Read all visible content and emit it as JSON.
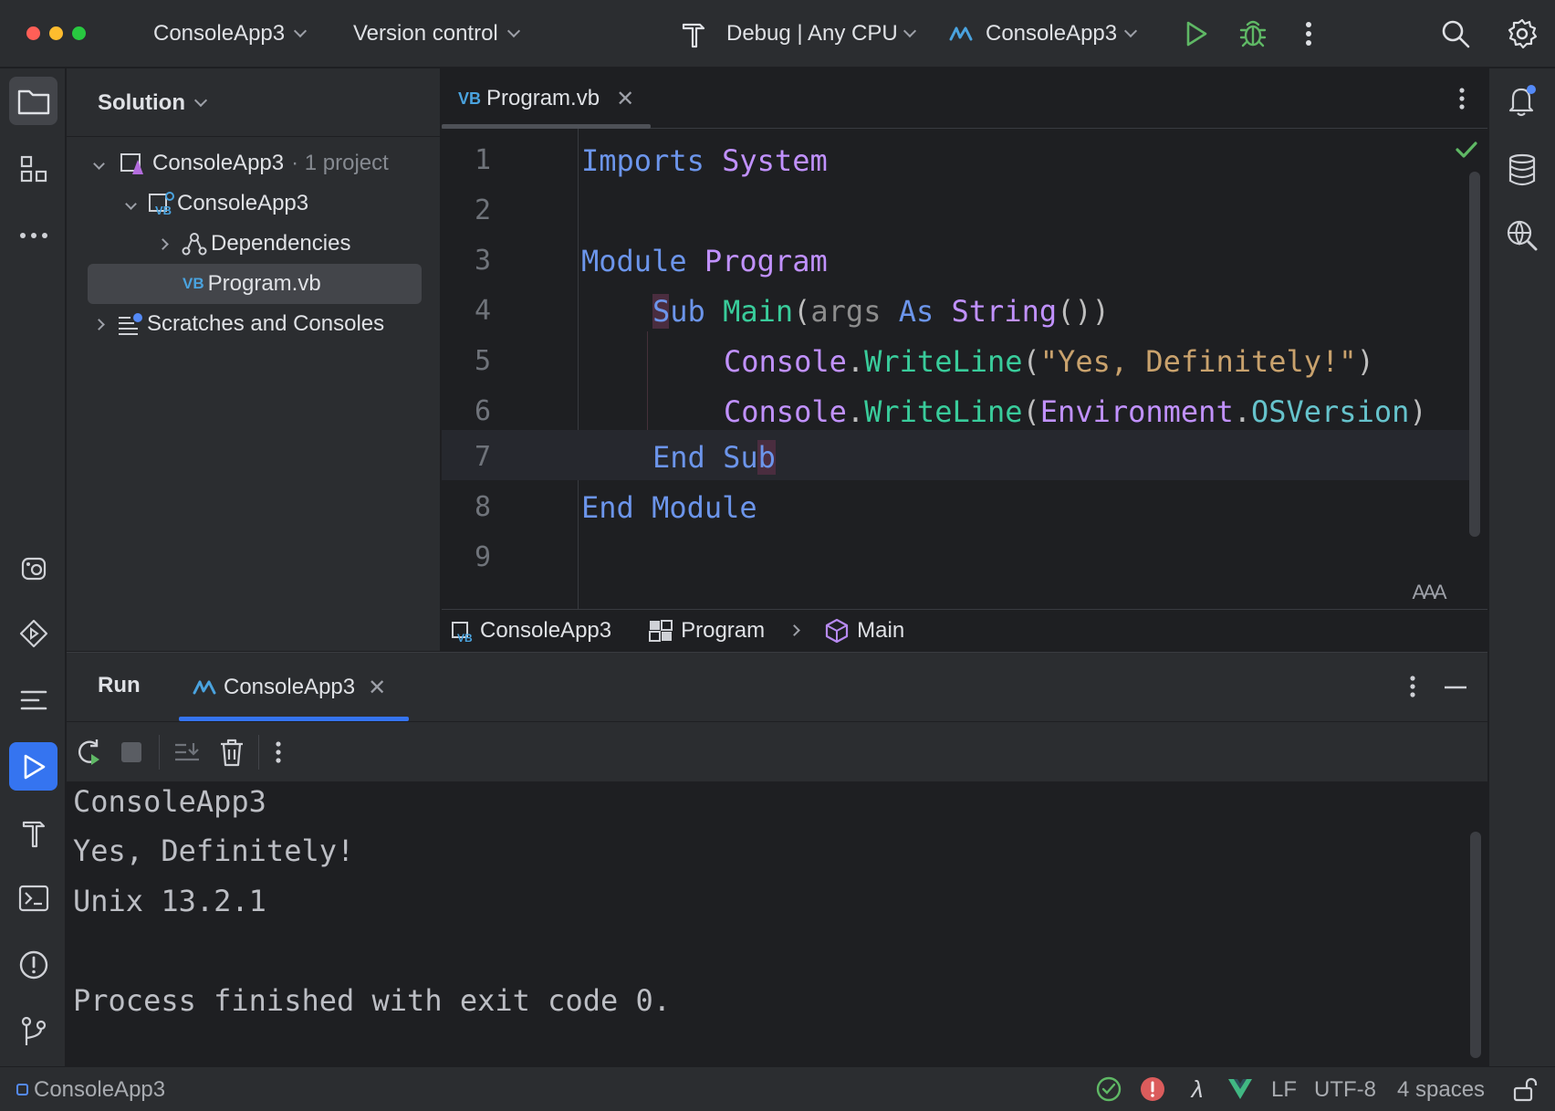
{
  "titlebar": {
    "project_name": "ConsoleApp3",
    "vcs_label": "Version control",
    "config_label": "Debug | Any CPU",
    "run_target": "ConsoleApp3"
  },
  "project_panel": {
    "title": "Solution",
    "tree": [
      {
        "label": "ConsoleApp3",
        "suffix": "· 1 project"
      },
      {
        "label": "ConsoleApp3"
      },
      {
        "label": "Dependencies"
      },
      {
        "label": "Program.vb"
      },
      {
        "label": "Scratches and Consoles"
      }
    ]
  },
  "editor": {
    "tab_label": "Program.vb",
    "tab_badge": "VB",
    "line_numbers": [
      "1",
      "2",
      "3",
      "4",
      "5",
      "6",
      "7",
      "8",
      "9"
    ],
    "code": {
      "l1": [
        "Imports",
        " ",
        "System"
      ],
      "l3": [
        "Module",
        " ",
        "Program"
      ],
      "l4": [
        "Sub",
        " ",
        "Main",
        "(",
        "args",
        " ",
        "As",
        " ",
        "String",
        "())"
      ],
      "l5": [
        "Console",
        ".",
        "WriteLine",
        "(",
        "\"Yes, Definitely!\"",
        ")"
      ],
      "l6": [
        "Console",
        ".",
        "WriteLine",
        "(",
        "Environment",
        ".",
        "OSVersion",
        ")"
      ],
      "l7": [
        "End",
        " ",
        "Sub"
      ],
      "l8": [
        "End",
        " ",
        "Module"
      ]
    },
    "breadcrumbs": [
      "ConsoleApp3",
      "Program",
      "Main"
    ],
    "reader_mode_label": "AAA"
  },
  "run_panel": {
    "title": "Run",
    "tab_label": "ConsoleApp3",
    "output": [
      "ConsoleApp3",
      "Yes, Definitely!",
      "Unix 13.2.1",
      "",
      "Process finished with exit code 0."
    ]
  },
  "statusbar": {
    "project": "ConsoleApp3",
    "line_ending": "LF",
    "encoding": "UTF-8",
    "indent": "4 spaces"
  },
  "colors": {
    "accent": "#3574f0",
    "run_green": "#5fb865",
    "error_red": "#db5c5c",
    "keyword": "#6c95eb",
    "type": "#c191ff",
    "method": "#39cc9b",
    "string": "#c9a26d"
  }
}
